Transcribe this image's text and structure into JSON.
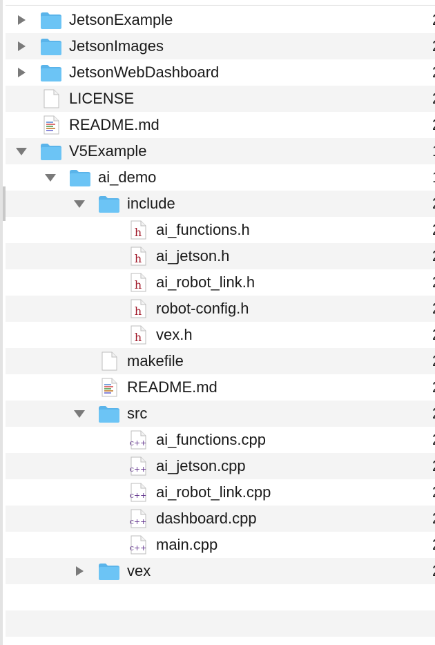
{
  "rows": [
    {
      "name": "JetsonExample",
      "type": "folder",
      "depth": 0,
      "expander": "collapsed",
      "size": "2"
    },
    {
      "name": "JetsonImages",
      "type": "folder",
      "depth": 0,
      "expander": "collapsed",
      "size": "2"
    },
    {
      "name": "JetsonWebDashboard",
      "type": "folder",
      "depth": 0,
      "expander": "collapsed",
      "size": "2"
    },
    {
      "name": "LICENSE",
      "type": "file",
      "depth": 0,
      "expander": "none",
      "size": "2"
    },
    {
      "name": "README.md",
      "type": "md",
      "depth": 0,
      "expander": "none",
      "size": "2"
    },
    {
      "name": "V5Example",
      "type": "folder",
      "depth": 0,
      "expander": "expanded",
      "size": "1"
    },
    {
      "name": "ai_demo",
      "type": "folder",
      "depth": 1,
      "expander": "expanded",
      "size": "1"
    },
    {
      "name": "include",
      "type": "folder",
      "depth": 2,
      "expander": "expanded",
      "size": "2"
    },
    {
      "name": "ai_functions.h",
      "type": "h",
      "depth": 3,
      "expander": "none",
      "size": "2"
    },
    {
      "name": "ai_jetson.h",
      "type": "h",
      "depth": 3,
      "expander": "none",
      "size": "2"
    },
    {
      "name": "ai_robot_link.h",
      "type": "h",
      "depth": 3,
      "expander": "none",
      "size": "2"
    },
    {
      "name": "robot-config.h",
      "type": "h",
      "depth": 3,
      "expander": "none",
      "size": "2"
    },
    {
      "name": "vex.h",
      "type": "h",
      "depth": 3,
      "expander": "none",
      "size": "2"
    },
    {
      "name": "makefile",
      "type": "file",
      "depth": 2,
      "expander": "none",
      "size": "2"
    },
    {
      "name": "README.md",
      "type": "md",
      "depth": 2,
      "expander": "none",
      "size": "2"
    },
    {
      "name": "src",
      "type": "folder",
      "depth": 2,
      "expander": "expanded",
      "size": "2"
    },
    {
      "name": "ai_functions.cpp",
      "type": "cpp",
      "depth": 3,
      "expander": "none",
      "size": "2"
    },
    {
      "name": "ai_jetson.cpp",
      "type": "cpp",
      "depth": 3,
      "expander": "none",
      "size": "2"
    },
    {
      "name": "ai_robot_link.cpp",
      "type": "cpp",
      "depth": 3,
      "expander": "none",
      "size": "2"
    },
    {
      "name": "dashboard.cpp",
      "type": "cpp",
      "depth": 3,
      "expander": "none",
      "size": "2"
    },
    {
      "name": "main.cpp",
      "type": "cpp",
      "depth": 3,
      "expander": "none",
      "size": "2"
    },
    {
      "name": "vex",
      "type": "folder",
      "depth": 2,
      "expander": "collapsed",
      "size": "2"
    }
  ],
  "empty_rows": 2,
  "colors": {
    "folder": "#6cc4f5",
    "folder_tab": "#5ab4ea",
    "header_glyph": "#a01828",
    "cpp_glyph": "#5a2a88",
    "disclosure": "#7a7a7a",
    "stripe": "#f4f4f4"
  }
}
